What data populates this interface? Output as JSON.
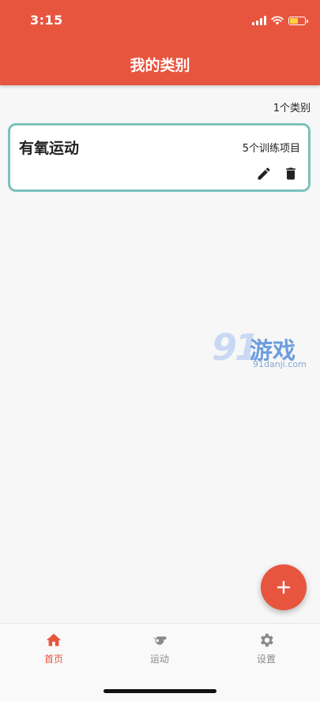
{
  "status_bar": {
    "time": "3:15"
  },
  "header": {
    "title": "我的类别"
  },
  "summary": {
    "count_label": "1个类别"
  },
  "categories": [
    {
      "name": "有氧运动",
      "subtitle": "5个训练项目",
      "actions": [
        "edit-icon",
        "delete-icon"
      ]
    }
  ],
  "watermark": {
    "number": "91",
    "text": "游戏",
    "url": "91danji.com"
  },
  "fab": {
    "icon": "plus-icon"
  },
  "tabs": [
    {
      "label": "首页",
      "icon": "home-icon",
      "active": true
    },
    {
      "label": "运动",
      "icon": "whistle-icon",
      "active": false
    },
    {
      "label": "设置",
      "icon": "gear-icon",
      "active": false
    }
  ],
  "colors": {
    "accent": "#e8553f",
    "card_border": "#7cc2ba",
    "inactive": "#8a8a8a"
  }
}
